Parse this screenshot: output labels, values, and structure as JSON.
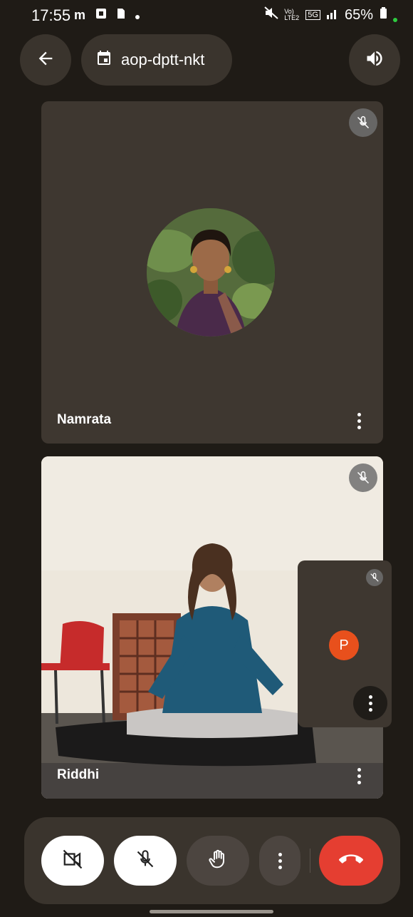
{
  "status_bar": {
    "time": "17:55",
    "left_icons": [
      "m",
      "photo-icon",
      "sim-icon",
      "dot-icon"
    ],
    "network_label": "Vo) LTE2",
    "network_type": "5G",
    "battery": "65%"
  },
  "header": {
    "meeting_code": "aop-dptt-nkt",
    "back_icon": "back-arrow-icon",
    "calendar_icon": "calendar-icon",
    "audio_icon": "speaker-icon"
  },
  "participants": [
    {
      "name": "Namrata",
      "muted": true,
      "video": false
    },
    {
      "name": "Riddhi",
      "muted": true,
      "video": true
    }
  ],
  "self_tile": {
    "initial": "P",
    "muted": true,
    "avatar_color": "#e8501c"
  },
  "controls": {
    "camera": "camera-off-icon",
    "mic": "mic-off-icon",
    "hand": "raise-hand-icon",
    "more": "more-vert-icon",
    "end_call": "end-call-icon",
    "end_color": "#e53e31"
  }
}
